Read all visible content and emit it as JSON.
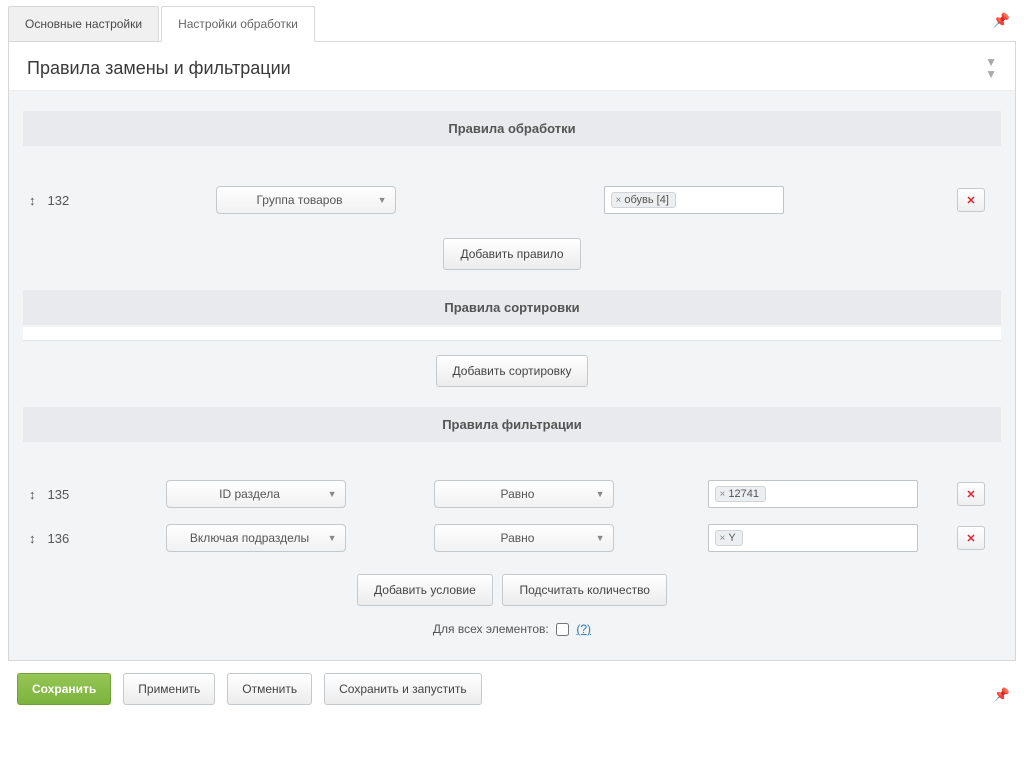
{
  "tabs": {
    "main": "Основные настройки",
    "processing": "Настройки обработки"
  },
  "panel": {
    "title": "Правила замены и фильтрации"
  },
  "sections": {
    "processing": "Правила обработки",
    "sorting": "Правила сортировки",
    "filtering": "Правила фильтрации"
  },
  "rules": {
    "r132": {
      "id": "132",
      "select": "Группа товаров",
      "tag": "обувь [4]"
    }
  },
  "buttons": {
    "add_rule": "Добавить правило",
    "add_sort": "Добавить сортировку",
    "add_condition": "Добавить условие",
    "count": "Подсчитать количество"
  },
  "filters": {
    "f135": {
      "id": "135",
      "field": "ID раздела",
      "op": "Равно",
      "value": "12741"
    },
    "f136": {
      "id": "136",
      "field": "Включая подразделы",
      "op": "Равно",
      "value": "Y"
    }
  },
  "checkbox_row": {
    "label": "Для всех элементов:",
    "help": "(?)"
  },
  "footer": {
    "save": "Сохранить",
    "apply": "Применить",
    "cancel": "Отменить",
    "save_run": "Сохранить и запустить"
  }
}
